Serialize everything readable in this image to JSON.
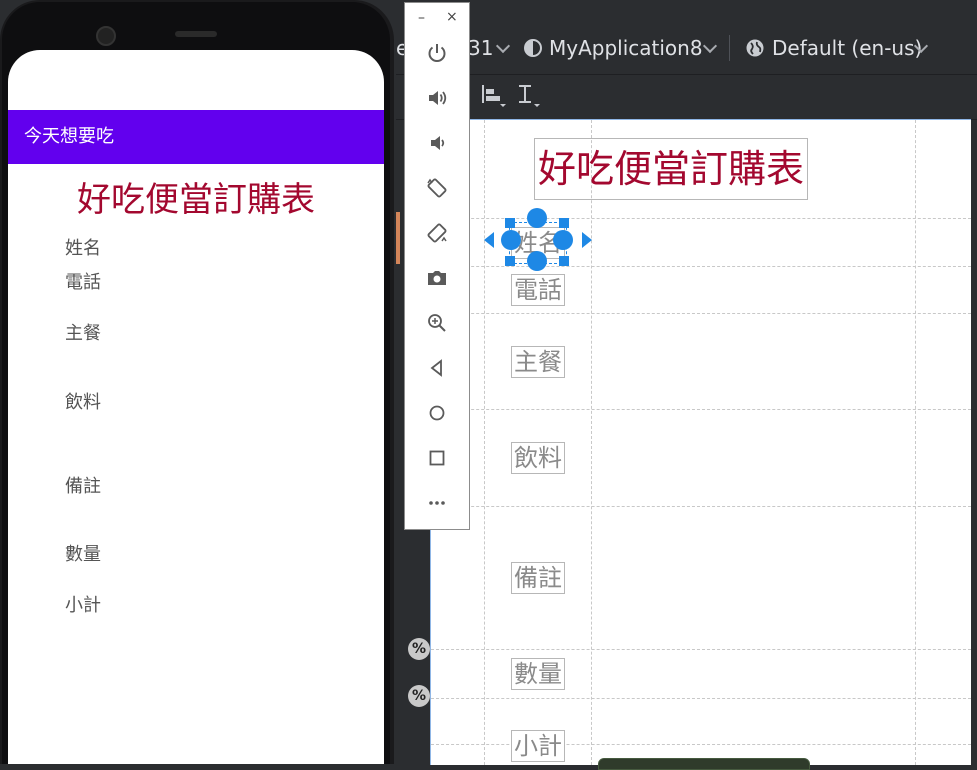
{
  "phone": {
    "app_bar_title": "今天想要吃",
    "form_title": "好吃便當訂購表",
    "labels": [
      "姓名",
      "電話",
      "主餐",
      "飲料",
      "備註",
      "數量",
      "小計"
    ]
  },
  "ide": {
    "toolbar": {
      "api_level_fragment": "31",
      "module_name": "MyApplication8",
      "locale": "Default (en-us)",
      "truncated_fragment": "e"
    },
    "design": {
      "title": "好吃便當訂購表",
      "labels": [
        "姓名",
        "電話",
        "主餐",
        "飲料",
        "備註",
        "數量",
        "小計"
      ],
      "percent_marker": "%"
    }
  },
  "emulator_panel": {
    "minimize_glyph": "–",
    "close_glyph": "×",
    "buttons": [
      "power-icon",
      "volume-up-icon",
      "volume-down-icon",
      "rotate-left-icon",
      "rotate-right-icon",
      "camera-icon",
      "zoom-icon",
      "back-icon",
      "home-icon",
      "overview-icon",
      "more-icon"
    ]
  },
  "colors": {
    "app_bar": "#6200ee",
    "title_red": "#a3082f",
    "selection_blue": "#1e88e5",
    "ide_bg": "#2b2d30"
  }
}
